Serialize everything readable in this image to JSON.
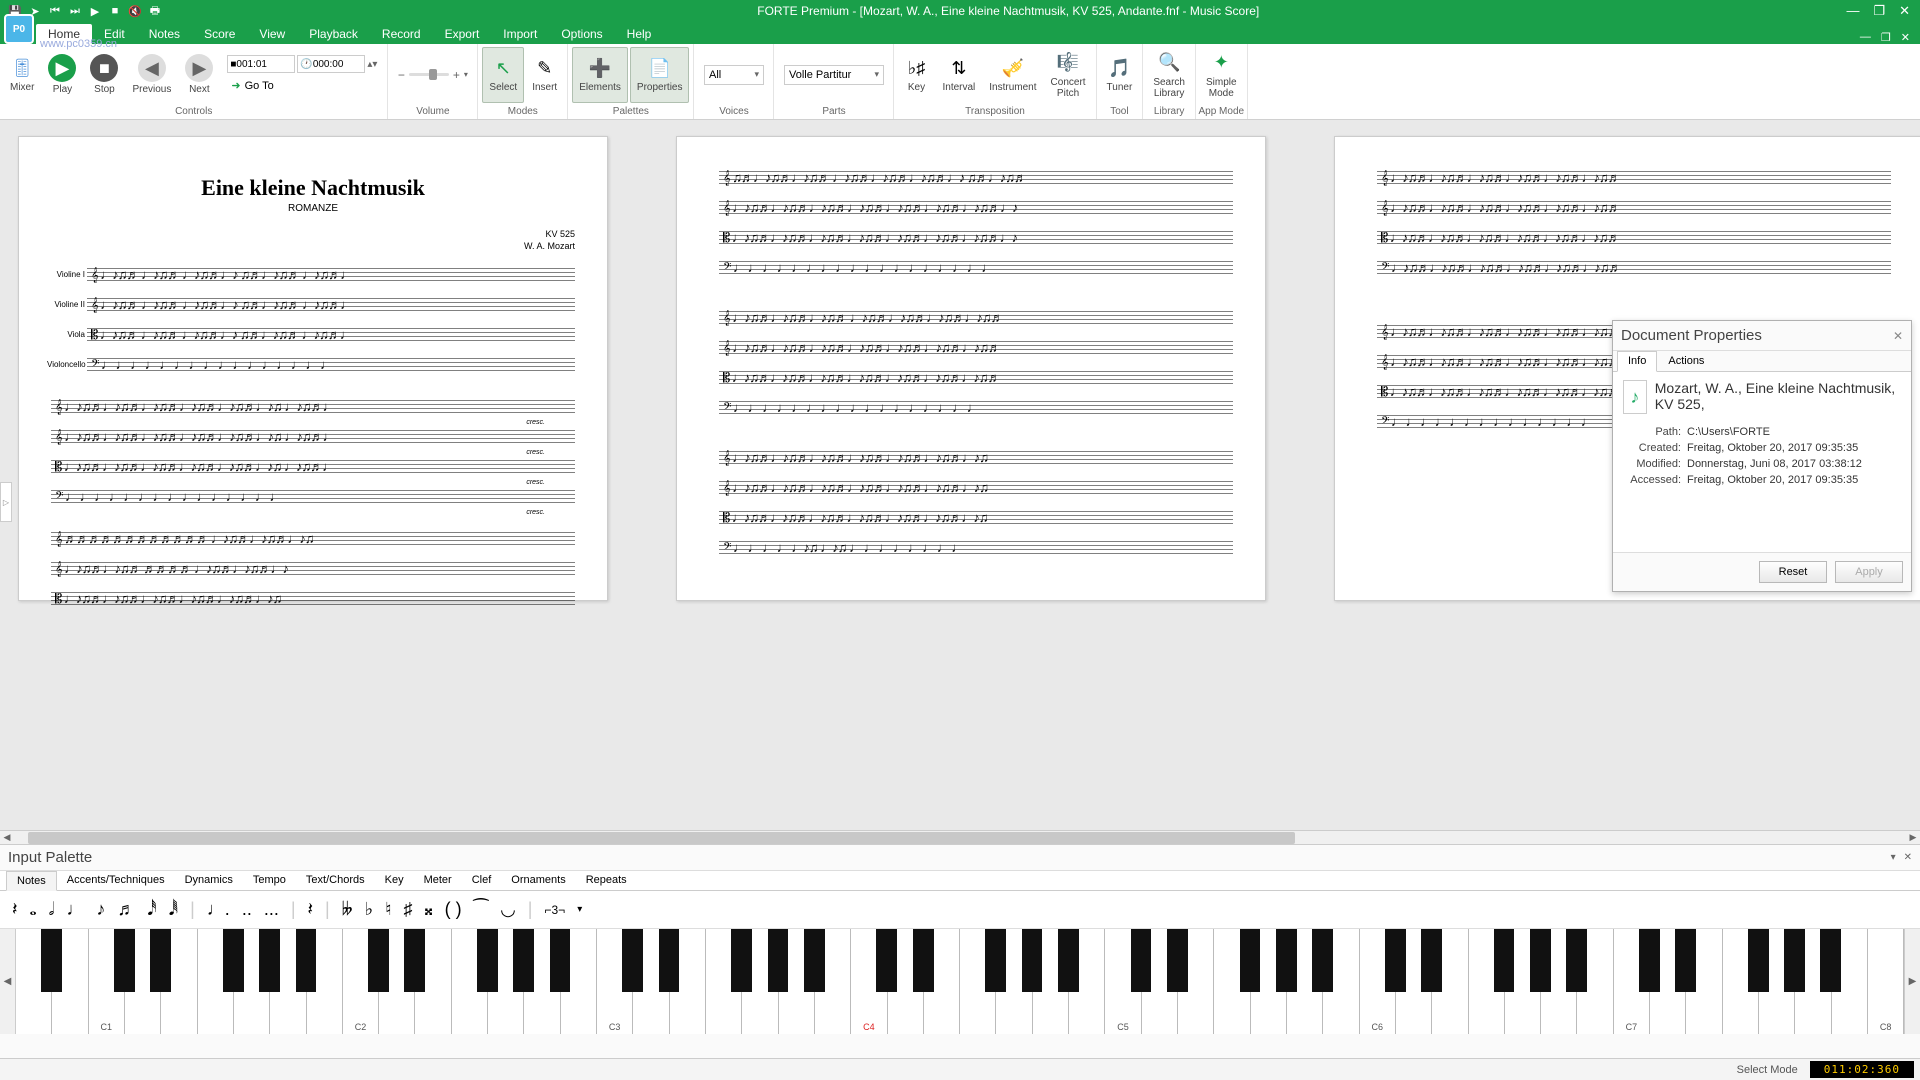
{
  "window": {
    "title": "FORTE Premium - [Mozart, W. A., Eine kleine Nachtmusik, KV 525, Andante.fnf - Music Score]",
    "watermark": "www.pc0359.cn"
  },
  "menu": [
    "Home",
    "Edit",
    "Notes",
    "Score",
    "View",
    "Playback",
    "Record",
    "Export",
    "Import",
    "Options",
    "Help"
  ],
  "ribbon": {
    "controls": {
      "mixer": "Mixer",
      "play": "Play",
      "stop": "Stop",
      "previous": "Previous",
      "next": "Next",
      "time1": "001:01",
      "time2": "000:00",
      "goto": "Go To",
      "label": "Controls"
    },
    "volume": {
      "label": "Volume"
    },
    "modes": {
      "select": "Select",
      "insert": "Insert",
      "label": "Modes"
    },
    "palettes": {
      "elements": "Elements",
      "properties": "Properties",
      "label": "Palettes"
    },
    "voices": {
      "all": "All",
      "label": "Voices"
    },
    "parts": {
      "volle": "Volle Partitur",
      "label": "Parts"
    },
    "transposition": {
      "key": "Key",
      "interval": "Interval",
      "instrument": "Instrument",
      "concert": "Concert\nPitch",
      "label": "Transposition"
    },
    "tool": {
      "tuner": "Tuner",
      "label": "Tool"
    },
    "library": {
      "search": "Search\nLibrary",
      "label": "Library"
    },
    "appmode": {
      "simple": "Simple\nMode",
      "label": "App Mode"
    }
  },
  "score": {
    "title": "Eine kleine Nachtmusik",
    "subtitle": "ROMANZE",
    "kv": "KV 525",
    "composer": "W. A. Mozart",
    "instruments": [
      "Violine I",
      "Violine II",
      "Viola",
      "Violoncello"
    ],
    "cresc": "cresc."
  },
  "docprops": {
    "title": "Document Properties",
    "tabs": [
      "Info",
      "Actions"
    ],
    "doctitle": "Mozart, W. A., Eine kleine Nachtmusik, KV 525,",
    "rows": [
      {
        "k": "Path:",
        "v": "C:\\Users\\FORTE"
      },
      {
        "k": "Created:",
        "v": "Freitag, Oktober 20, 2017 09:35:35"
      },
      {
        "k": "Modified:",
        "v": "Donnerstag, Juni 08, 2017 03:38:12"
      },
      {
        "k": "Accessed:",
        "v": "Freitag, Oktober 20, 2017 09:35:35"
      }
    ],
    "reset": "Reset",
    "apply": "Apply"
  },
  "palette": {
    "title": "Input Palette",
    "tabs": [
      "Notes",
      "Accents/Techniques",
      "Dynamics",
      "Tempo",
      "Text/Chords",
      "Key",
      "Meter",
      "Clef",
      "Ornaments",
      "Repeats"
    ]
  },
  "piano_labels": [
    "C1",
    "C2",
    "C3",
    "C4",
    "C5",
    "C6",
    "C7",
    "C8"
  ],
  "status": {
    "mode": "Select Mode",
    "counter": "011:02:360"
  }
}
